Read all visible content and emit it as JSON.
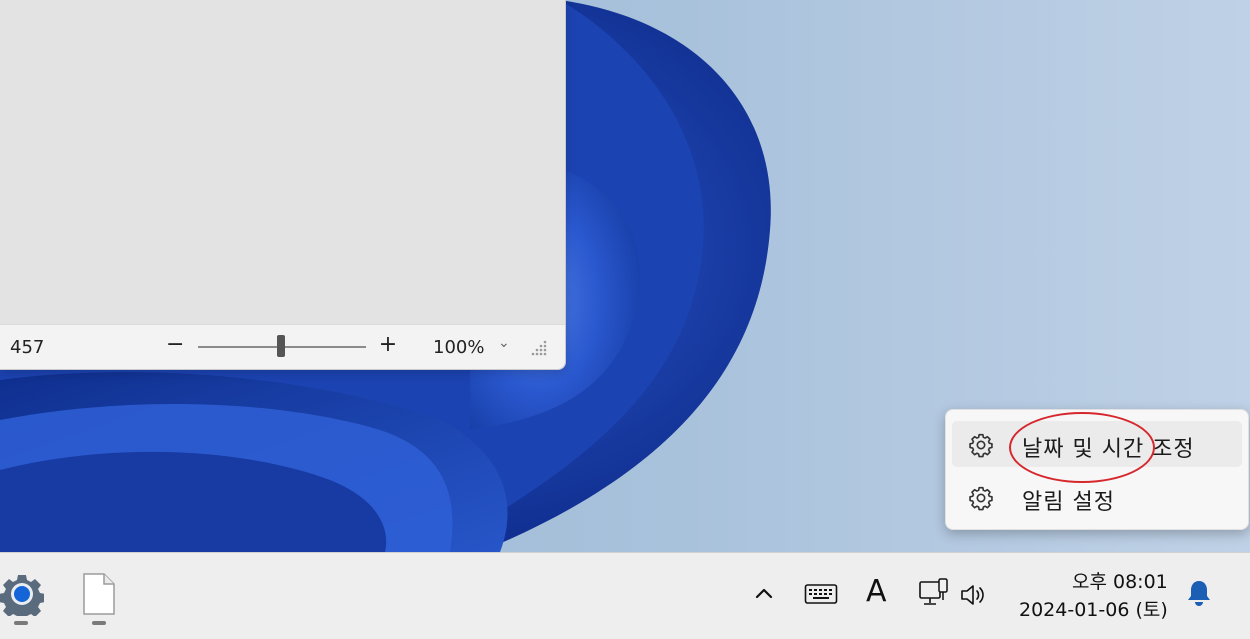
{
  "window": {
    "status_left": "457",
    "zoom": {
      "minus": "−",
      "plus": "+",
      "value": "100%",
      "level_percent": 100
    }
  },
  "context_menu": {
    "items": [
      {
        "label": "날짜 및 시간 조정",
        "icon": "gear-icon"
      },
      {
        "label": "알림 설정",
        "icon": "gear-icon"
      }
    ]
  },
  "taskbar": {
    "apps": [
      {
        "icon": "settings-gear-icon"
      },
      {
        "icon": "blank-file-icon"
      }
    ],
    "tray": {
      "ime_label": "A",
      "time": "오후 08:01",
      "date": "2024-01-06 (토)"
    }
  },
  "colors": {
    "annotation": "#d6272d",
    "accent": "#1a5fb4",
    "wallpaper_blue": "#2852c2"
  }
}
